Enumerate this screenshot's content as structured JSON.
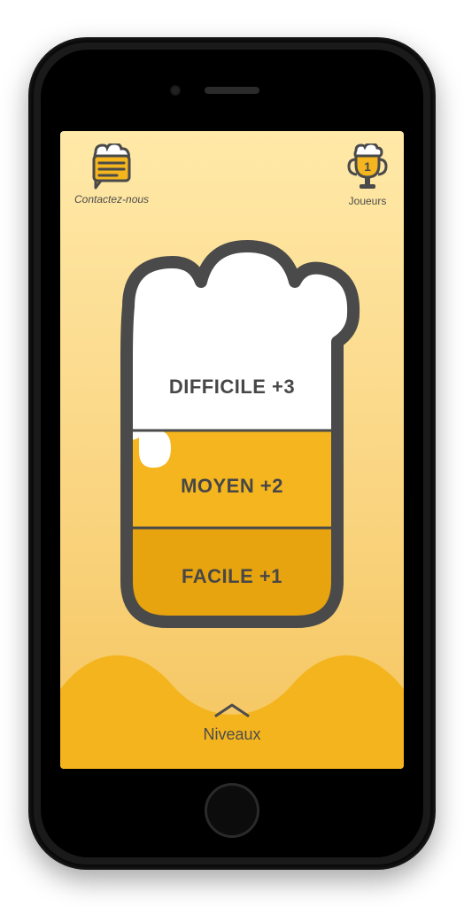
{
  "header": {
    "contact_label": "Contactez-nous",
    "players_label": "Joueurs"
  },
  "levels": {
    "hard": "DIFFICILE +3",
    "medium": "MOYEN +2",
    "easy": "FACILE +1"
  },
  "footer": {
    "levels_label": "Niveaux"
  },
  "colors": {
    "outline": "#4a4a4a",
    "foam": "#ffffff",
    "beer_top": "#f4b51e",
    "beer_bottom": "#e7a40e",
    "wave": "#f3b41d"
  }
}
